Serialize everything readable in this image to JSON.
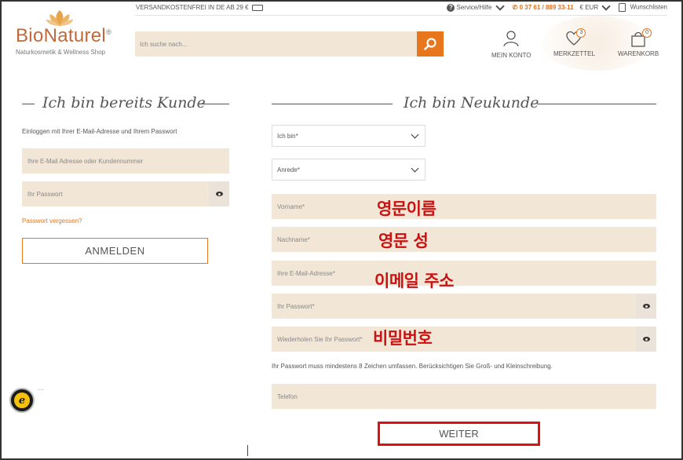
{
  "topbar": {
    "shipping": "VERSANDKOSTENFREI IN DE AB 29 €",
    "service": "Service/Hilfe",
    "phone": "0 37 61 / 889 33-11",
    "currency": "€ EUR",
    "wishlists": "Wunschlisten"
  },
  "logo": {
    "brand": "BioNaturel",
    "reg": "®",
    "tagline": "Naturkosmetik & Wellness Shop"
  },
  "search": {
    "placeholder": "Ich suche nach..."
  },
  "header": {
    "account": "MEIN KONTO",
    "wishlist": "MERKZETTEL",
    "wishlist_count": "3",
    "cart": "WARENKORB",
    "cart_count": "0"
  },
  "login": {
    "title": "Ich bin bereits Kunde",
    "hint": "Einloggen mit Ihrer E-Mail-Adresse und Ihrem Passwort",
    "email_placeholder": "Ihre E-Mail Adresse oder Kundennummer",
    "password_placeholder": "Ihr Passwort",
    "forgot": "Passwort vergessen?",
    "submit": "ANMELDEN"
  },
  "register": {
    "title": "Ich bin Neukunde",
    "type_select": "Ich bin*",
    "salutation_select": "Anrede*",
    "firstname": "Vorname*",
    "lastname": "Nachname*",
    "email": "Ihre E-Mail-Adresse*",
    "password": "Ihr Passwort*",
    "password_repeat": "Wiederholen Sie Ihr Passwort*",
    "password_hint": "Ihr Passwort muss mindestens 8 Zeichen umfassen. Berücksichtigen Sie Groß- und Kleinschreibung.",
    "phone": "Telefon",
    "submit": "WEITER"
  },
  "annotations": {
    "firstname": "영문이름",
    "lastname": "영문 성",
    "email": "이메일 주소",
    "password": "비밀번호"
  },
  "colors": {
    "accent": "#e8761c",
    "field_bg": "#f2e6d6",
    "annotation_red": "#cc1111"
  }
}
